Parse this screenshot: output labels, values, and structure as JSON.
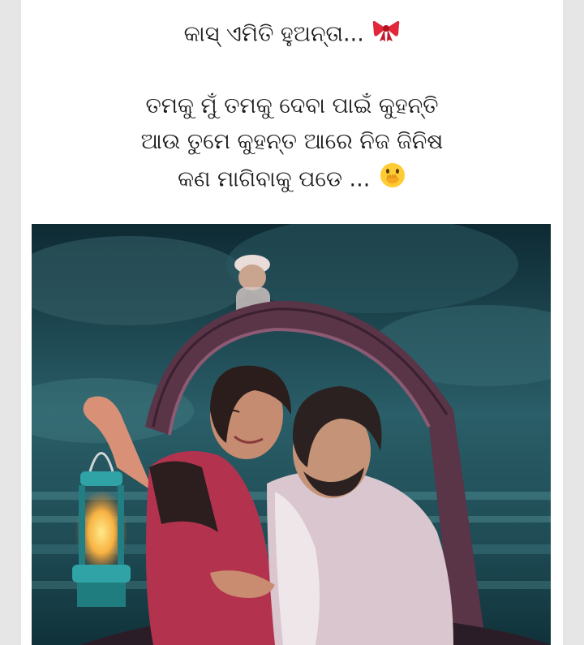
{
  "post": {
    "caption": {
      "title": "କାସ୍ ଏମିତି ହୁଅନ୍ତା...",
      "title_emoji": "ribbon-icon",
      "line1": "ତମକୁ ମୁଁ ତମକୁ ଦେବା ପାଇଁ କୁହନ୍ତି",
      "line2": "ଆଉ ତୁମେ କୁହନ୍ତ ଆରେ ନିଜ ଜିନିଷ",
      "line3": "କଣ ମାଗିବାକୁ ପଡେ ...",
      "line3_emoji": "face-with-hand-over-mouth-icon"
    },
    "image": {
      "subject": "illustration-couple-in-boat-with-lantern",
      "colors": {
        "sky_dark": "#0e2a33",
        "sky_teal": "#2f6f78",
        "water": "#3f8a94",
        "boat": "#6b3f56",
        "lantern": "#2fa3a6",
        "saree": "#b3334f",
        "kurta": "#d9c6cf"
      }
    }
  }
}
